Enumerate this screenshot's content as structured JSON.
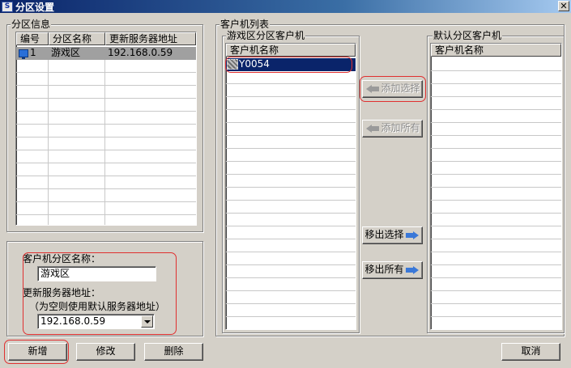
{
  "window": {
    "title": "分区设置",
    "app_icon_glyph": "S",
    "close_glyph": "✕"
  },
  "partition_info": {
    "group_label": "分区信息",
    "columns": [
      "编号",
      "分区名称",
      "更新服务器地址"
    ],
    "rows": [
      {
        "id": "1",
        "name": "游戏区",
        "server": "192.168.0.59",
        "icon": "computer-icon"
      }
    ]
  },
  "edit_form": {
    "name_label": "客户机分区名称：",
    "name_value": "游戏区",
    "server_label": "更新服务器地址：",
    "server_hint": "（为空则使用默认服务器地址）",
    "server_value": "192.168.0.59"
  },
  "client_list": {
    "group_label": "客户机列表",
    "game_zone": {
      "group_label": "游戏区分区客户机",
      "column": "客户机名称",
      "items": [
        {
          "name": "Y0054",
          "icon": "client-computer-icon",
          "selected": true
        }
      ]
    },
    "default_zone": {
      "group_label": "默认分区客户机",
      "column": "客户机名称",
      "items": []
    },
    "buttons": {
      "add_selected": "添加选择",
      "add_all": "添加所有",
      "remove_selected": "移出选择",
      "remove_all": "移出所有"
    }
  },
  "footer": {
    "add": "新增",
    "modify": "修改",
    "delete": "删除",
    "cancel": "取消"
  },
  "colors": {
    "face": "#d4d0c8",
    "selection_blue": "#0a246a",
    "annotation_red": "#e03030"
  }
}
